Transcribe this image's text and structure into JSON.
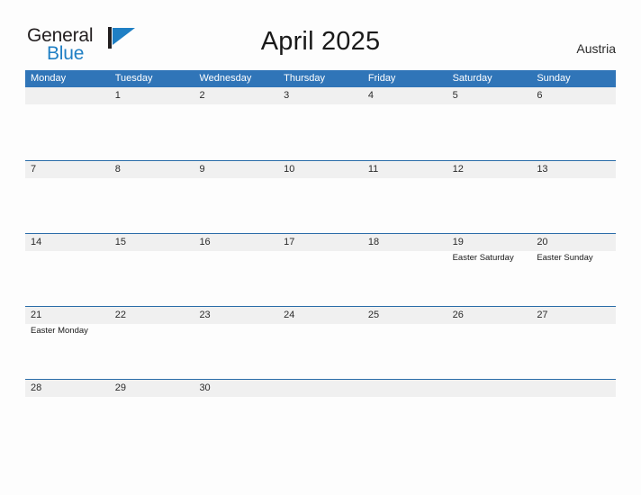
{
  "brand": {
    "name_part1": "General",
    "name_part2": "Blue",
    "mark_icon": "triangle-flag-icon",
    "color_dark": "#231f20",
    "color_blue": "#1f7fc4"
  },
  "header": {
    "title": "April 2025",
    "country": "Austria"
  },
  "theme": {
    "header_blue": "#3075b8",
    "row_line_blue": "#2a6ca8",
    "date_band_gray": "#f0f0f0",
    "page_background": "#fdfdfd",
    "text_dark": "#2b2b2b"
  },
  "calendar": {
    "weekdays": [
      "Monday",
      "Tuesday",
      "Wednesday",
      "Thursday",
      "Friday",
      "Saturday",
      "Sunday"
    ],
    "weeks": [
      [
        {
          "date": "",
          "events": []
        },
        {
          "date": "1",
          "events": []
        },
        {
          "date": "2",
          "events": []
        },
        {
          "date": "3",
          "events": []
        },
        {
          "date": "4",
          "events": []
        },
        {
          "date": "5",
          "events": []
        },
        {
          "date": "6",
          "events": []
        }
      ],
      [
        {
          "date": "7",
          "events": []
        },
        {
          "date": "8",
          "events": []
        },
        {
          "date": "9",
          "events": []
        },
        {
          "date": "10",
          "events": []
        },
        {
          "date": "11",
          "events": []
        },
        {
          "date": "12",
          "events": []
        },
        {
          "date": "13",
          "events": []
        }
      ],
      [
        {
          "date": "14",
          "events": []
        },
        {
          "date": "15",
          "events": []
        },
        {
          "date": "16",
          "events": []
        },
        {
          "date": "17",
          "events": []
        },
        {
          "date": "18",
          "events": []
        },
        {
          "date": "19",
          "events": [
            "Easter Saturday"
          ]
        },
        {
          "date": "20",
          "events": [
            "Easter Sunday"
          ]
        }
      ],
      [
        {
          "date": "21",
          "events": [
            "Easter Monday"
          ]
        },
        {
          "date": "22",
          "events": []
        },
        {
          "date": "23",
          "events": []
        },
        {
          "date": "24",
          "events": []
        },
        {
          "date": "25",
          "events": []
        },
        {
          "date": "26",
          "events": []
        },
        {
          "date": "27",
          "events": []
        }
      ],
      [
        {
          "date": "28",
          "events": []
        },
        {
          "date": "29",
          "events": []
        },
        {
          "date": "30",
          "events": []
        },
        {
          "date": "",
          "events": []
        },
        {
          "date": "",
          "events": []
        },
        {
          "date": "",
          "events": []
        },
        {
          "date": "",
          "events": []
        }
      ]
    ]
  }
}
